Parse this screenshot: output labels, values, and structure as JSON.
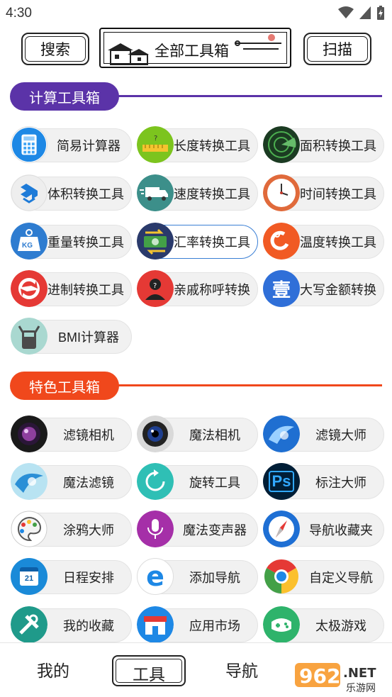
{
  "status_bar": {
    "time": "4:30"
  },
  "top_bar": {
    "search_label": "搜索",
    "all_tools_label": "全部工具箱",
    "scan_label": "扫描"
  },
  "sections": {
    "calc": {
      "title": "计算工具箱",
      "color": "#5b33a8"
    },
    "featured": {
      "title": "特色工具箱",
      "color": "#f0481c"
    }
  },
  "calc_tools": [
    {
      "label": "简易计算器",
      "icon": "calculator-icon"
    },
    {
      "label": "长度转换工具",
      "icon": "ruler-icon"
    },
    {
      "label": "面积转换工具",
      "icon": "radar-icon"
    },
    {
      "label": "体积转换工具",
      "icon": "box-icon"
    },
    {
      "label": "速度转换工具",
      "icon": "truck-icon"
    },
    {
      "label": "时间转换工具",
      "icon": "clock-icon"
    },
    {
      "label": "重量转换工具",
      "icon": "weight-icon",
      "badge": "KG"
    },
    {
      "label": "汇率转换工具",
      "icon": "money-exchange-icon"
    },
    {
      "label": "温度转换工具",
      "icon": "temperature-icon"
    },
    {
      "label": "进制转换工具",
      "icon": "convert-arrows-icon"
    },
    {
      "label": "亲戚称呼转换",
      "icon": "person-icon"
    },
    {
      "label": "大写金额转换",
      "icon": "chinese-numeral-icon",
      "glyph": "壹"
    },
    {
      "label": "BMI计算器",
      "icon": "scale-icon"
    }
  ],
  "featured_tools": [
    {
      "label": "滤镜相机",
      "icon": "lens-icon"
    },
    {
      "label": "魔法相机",
      "icon": "camera-icon"
    },
    {
      "label": "滤镜大师",
      "icon": "filter-icon"
    },
    {
      "label": "魔法滤镜",
      "icon": "magic-filter-icon"
    },
    {
      "label": "旋转工具",
      "icon": "rotate-icon"
    },
    {
      "label": "标注大师",
      "icon": "photoshop-icon",
      "glyph": "Ps"
    },
    {
      "label": "涂鸦大师",
      "icon": "palette-icon"
    },
    {
      "label": "魔法变声器",
      "icon": "microphone-icon"
    },
    {
      "label": "导航收藏夹",
      "icon": "compass-icon"
    },
    {
      "label": "日程安排",
      "icon": "calendar-icon",
      "glyph": "21"
    },
    {
      "label": "添加导航",
      "icon": "browser-e-icon",
      "glyph": "e"
    },
    {
      "label": "自定义导航",
      "icon": "chrome-icon"
    },
    {
      "label": "我的收藏",
      "icon": "tools-icon"
    },
    {
      "label": "应用市场",
      "icon": "store-icon"
    },
    {
      "label": "太极游戏",
      "icon": "gamepad-icon"
    }
  ],
  "bottom_nav": {
    "mine": "我的",
    "tools": "工具",
    "nav": "导航",
    "watermark": "962 NET 乐游网"
  }
}
